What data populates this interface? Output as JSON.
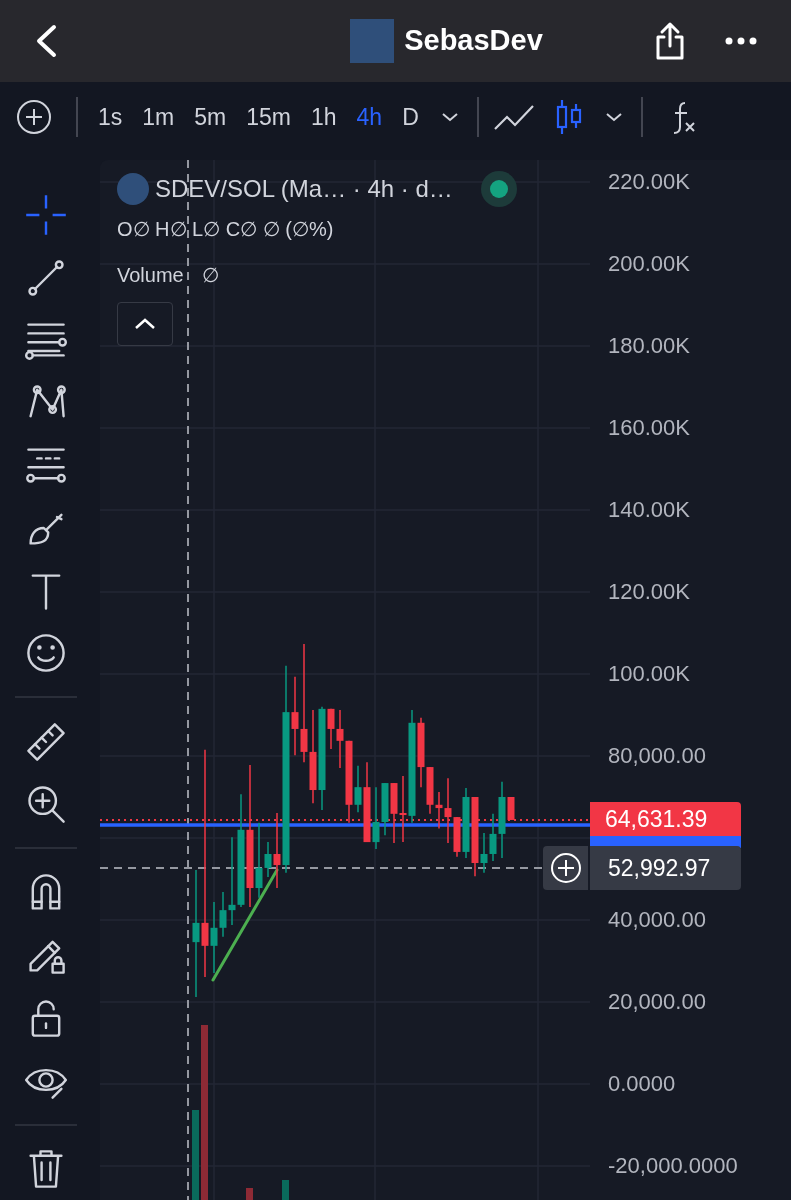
{
  "header": {
    "title": "SebasDev"
  },
  "toolbar": {
    "intervals": [
      {
        "label": "1s",
        "selected": false
      },
      {
        "label": "1m",
        "selected": false
      },
      {
        "label": "5m",
        "selected": false
      },
      {
        "label": "15m",
        "selected": false
      },
      {
        "label": "1h",
        "selected": false
      },
      {
        "label": "4h",
        "selected": true
      },
      {
        "label": "D",
        "selected": false
      }
    ],
    "chart_types": [
      {
        "kind": "line",
        "selected": false
      },
      {
        "kind": "candles",
        "selected": true
      }
    ]
  },
  "tool_groups": [
    [
      {
        "kind": "crosshair",
        "selected": true
      },
      {
        "kind": "trend-line",
        "selected": false
      },
      {
        "kind": "fib",
        "selected": false
      },
      {
        "kind": "pattern",
        "selected": false
      },
      {
        "kind": "projection",
        "selected": false
      },
      {
        "kind": "brush",
        "selected": false
      },
      {
        "kind": "text",
        "selected": false
      },
      {
        "kind": "emoji",
        "selected": false
      }
    ],
    [
      {
        "kind": "ruler",
        "selected": false
      },
      {
        "kind": "zoom",
        "selected": false
      }
    ],
    [
      {
        "kind": "magnet",
        "selected": false
      },
      {
        "kind": "pencil-lock",
        "selected": false
      },
      {
        "kind": "lock",
        "selected": false
      },
      {
        "kind": "eye",
        "selected": false
      }
    ],
    [
      {
        "kind": "trash",
        "selected": false
      }
    ]
  ],
  "legend": {
    "title": "SDEV/SOL (Ma… · 4h · d…",
    "ohlc": "O∅ H∅ L∅ C∅ ∅ (∅%)",
    "volume_label": "Volume",
    "volume_value": "∅"
  },
  "chart_data": {
    "type": "candlestick",
    "grid": true,
    "ylim": [
      -20000,
      220000
    ],
    "ohlc": [
      [
        34600,
        52200,
        21200,
        39300
      ],
      [
        39300,
        81500,
        26100,
        33700
      ],
      [
        33700,
        44400,
        27100,
        38100
      ],
      [
        38100,
        46800,
        35900,
        42400
      ],
      [
        42400,
        60200,
        38800,
        43700
      ],
      [
        43700,
        70700,
        43200,
        62000
      ],
      [
        62000,
        77800,
        43200,
        47800
      ],
      [
        47800,
        63700,
        45400,
        52700
      ],
      [
        52700,
        59000,
        50500,
        56100
      ],
      [
        56100,
        66100,
        47800,
        53400
      ],
      [
        53400,
        102000,
        51500,
        90700
      ],
      [
        90700,
        99300,
        80200,
        86600
      ],
      [
        86600,
        107300,
        78500,
        81000
      ],
      [
        81000,
        91200,
        68500,
        71700
      ],
      [
        71700,
        92000,
        66800,
        91500
      ],
      [
        91500,
        91500,
        81700,
        86600
      ],
      [
        86600,
        91200,
        77100,
        83700
      ],
      [
        83700,
        83700,
        63700,
        68100
      ],
      [
        68100,
        77600,
        66300,
        72400
      ],
      [
        72400,
        78500,
        59000,
        59000
      ],
      [
        59000,
        72400,
        57300,
        63900
      ],
      [
        63900,
        73400,
        60700,
        73400
      ],
      [
        73400,
        73400,
        58800,
        65900
      ],
      [
        66100,
        75100,
        59000,
        65600
      ],
      [
        65400,
        91200,
        63700,
        88100
      ],
      [
        88100,
        89300,
        72400,
        77300
      ],
      [
        77300,
        77300,
        65900,
        68100
      ],
      [
        68100,
        71200,
        62300,
        67300
      ],
      [
        67300,
        74600,
        58800,
        65100
      ],
      [
        65100,
        65100,
        55400,
        56600
      ],
      [
        56600,
        72200,
        55100,
        70000
      ],
      [
        70000,
        70000,
        50700,
        53900
      ],
      [
        53900,
        61200,
        51500,
        56100
      ],
      [
        56100,
        65900,
        54400,
        61000
      ],
      [
        61000,
        73700,
        55100,
        70000
      ],
      [
        70000,
        70000,
        64400,
        64400
      ]
    ],
    "yticks": [
      {
        "value": 220000,
        "label": "220.00K"
      },
      {
        "value": 200000,
        "label": "200.00K"
      },
      {
        "value": 180000,
        "label": "180.00K"
      },
      {
        "value": 160000,
        "label": "160.00K"
      },
      {
        "value": 140000,
        "label": "140.00K"
      },
      {
        "value": 120000,
        "label": "120.00K"
      },
      {
        "value": 100000,
        "label": "100.00K"
      },
      {
        "value": 80000,
        "label": "80,000.00"
      },
      {
        "value": 40000,
        "label": "40,000.00"
      },
      {
        "value": 20000,
        "label": "20,000.00"
      },
      {
        "value": 0,
        "label": "0.0000"
      },
      {
        "value": -20000,
        "label": "-20,000.0000"
      }
    ]
  },
  "last_price": "64,631.39",
  "crosshair_price": "52,992.97"
}
